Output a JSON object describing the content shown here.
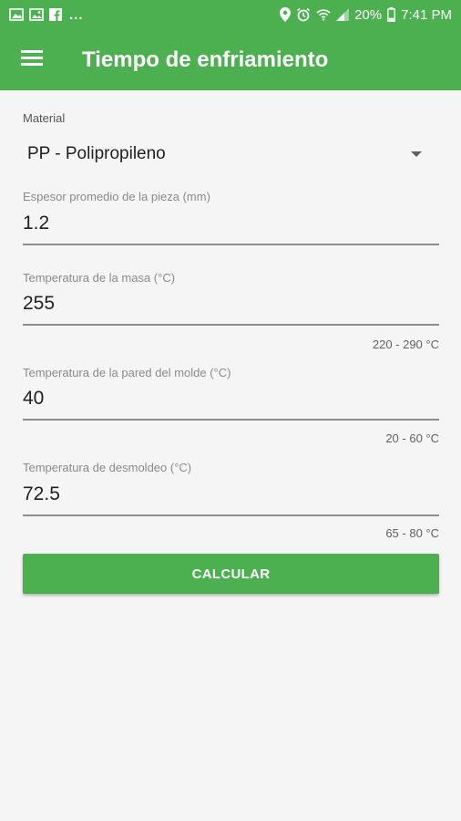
{
  "status_bar": {
    "time": "7:41 PM",
    "battery_percent": "20%",
    "notification_overflow": "..."
  },
  "app_bar": {
    "title": "Tiempo de enfriamiento"
  },
  "form": {
    "material": {
      "label": "Material",
      "value": "PP - Polipropileno"
    },
    "espesor": {
      "label": "Espesor promedio de la pieza (mm)",
      "value": "1.2"
    },
    "temp_masa": {
      "label": "Temperatura de la masa (°C)",
      "value": "255",
      "range": "220 - 290 °C"
    },
    "temp_pared": {
      "label": "Temperatura de la pared del molde (°C)",
      "value": "40",
      "range": "20 - 60 °C"
    },
    "temp_desmoldeo": {
      "label": "Temperatura de desmoldeo (°C)",
      "value": "72.5",
      "range": "65 - 80 °C"
    }
  },
  "calculate_button": {
    "label": "CALCULAR"
  },
  "colors": {
    "primary": "#4caf50",
    "background": "#f5f5f5",
    "text": "#212121",
    "hint": "#8a8a8a"
  }
}
